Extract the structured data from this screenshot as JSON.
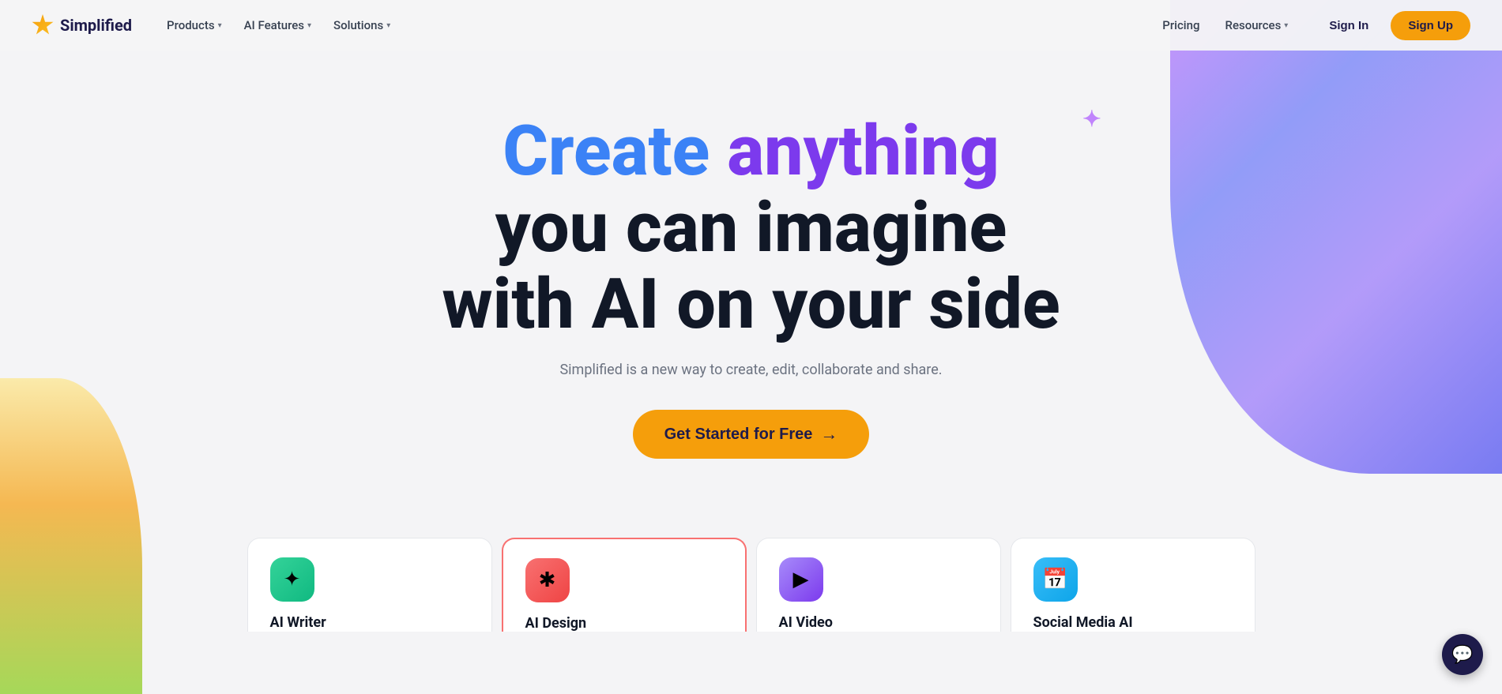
{
  "brand": {
    "name": "Simplified",
    "logo_icon": "⚡"
  },
  "nav": {
    "left": [
      {
        "label": "Products",
        "has_dropdown": true
      },
      {
        "label": "AI Features",
        "has_dropdown": true
      },
      {
        "label": "Solutions",
        "has_dropdown": true
      }
    ],
    "right_links": [
      {
        "label": "Pricing"
      },
      {
        "label": "Resources",
        "has_dropdown": true
      }
    ],
    "sign_in": "Sign In",
    "sign_up": "Sign Up"
  },
  "hero": {
    "line1_create": "Create anything",
    "line2": "you can imagine",
    "line3": "with AI on your side",
    "subtitle": "Simplified is a new way to create, edit, collaborate and share.",
    "cta_label": "Get Started for Free",
    "cta_arrow": "→"
  },
  "products": [
    {
      "name": "AI Writer",
      "icon": "✦",
      "icon_class": "icon-writer",
      "active": false
    },
    {
      "name": "AI Design",
      "icon": "✱",
      "icon_class": "icon-design",
      "active": true
    },
    {
      "name": "AI Video",
      "icon": "▶",
      "icon_class": "icon-video",
      "active": false
    },
    {
      "name": "Social Media AI",
      "icon": "📅",
      "icon_class": "icon-social",
      "active": false
    }
  ],
  "chat": {
    "icon": "💬"
  }
}
